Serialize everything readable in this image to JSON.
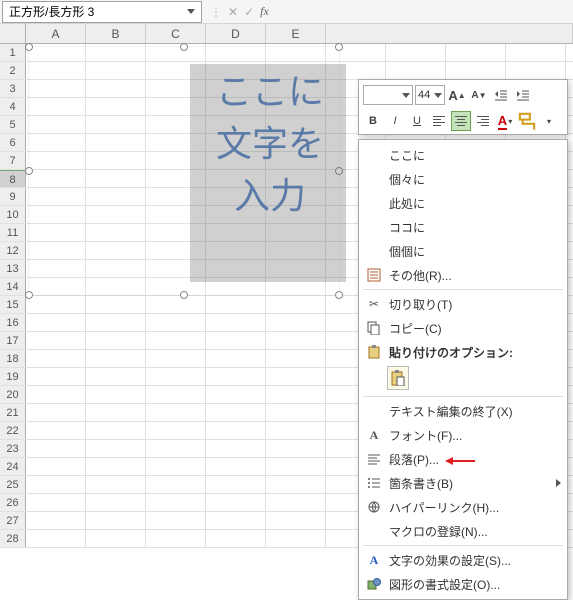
{
  "namebox": {
    "value": "正方形/長方形 3"
  },
  "fx": {
    "cancel": "✕",
    "ok": "✓",
    "label": "fx"
  },
  "columns": [
    "A",
    "B",
    "C",
    "D",
    "E"
  ],
  "rowCount": 28,
  "selectedRow": 8,
  "shapeText": {
    "l1": "ここに",
    "l2": "文字を",
    "l3": "入力"
  },
  "miniToolbar": {
    "fontName": "",
    "fontSize": "44",
    "growA": "A",
    "shrinkA": "A",
    "bold": "B",
    "italic": "I",
    "underline": "U",
    "fontColor": "A"
  },
  "ime": {
    "s1": "ここに",
    "s2": "個々に",
    "s3": "此処に",
    "s4": "ココに",
    "s5": "個個に"
  },
  "menu": {
    "other": "その他(R)...",
    "cut": "切り取り(T)",
    "copy": "コピー(C)",
    "pasteHeader": "貼り付けのオプション:",
    "endEdit": "テキスト編集の終了(X)",
    "font": "フォント(F)...",
    "para": "段落(P)...",
    "bullet": "箇条書き(B)",
    "link": "ハイパーリンク(H)...",
    "macro": "マクロの登録(N)...",
    "textfx": "文字の効果の設定(S)...",
    "shapefx": "図形の書式設定(O)..."
  }
}
